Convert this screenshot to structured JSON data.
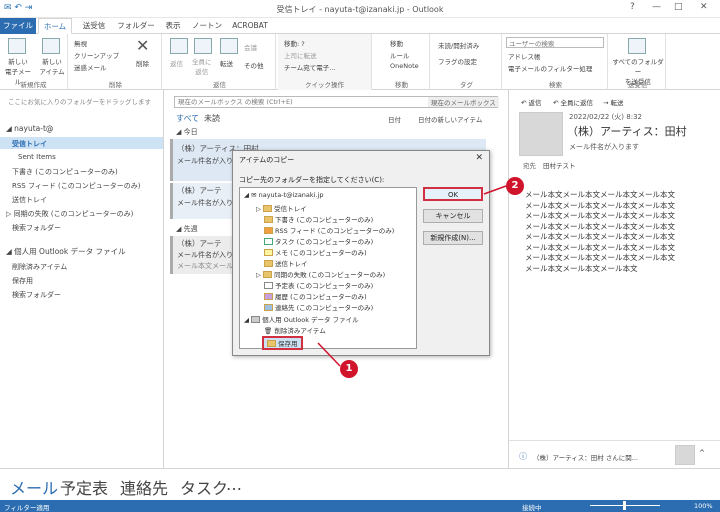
{
  "window": {
    "title": "受信トレイ - nayuta-t@izanaki.jp - Outlook",
    "controls": [
      "?",
      "—",
      "□",
      "✕"
    ]
  },
  "tabs": [
    "ファイル",
    "ホーム",
    "送受信",
    "フォルダー",
    "表示",
    "ノートン",
    "ACROBAT"
  ],
  "ribbon": {
    "new": {
      "new_mail": "新しい\n電子メール",
      "new_items": "新しい\nアイテム",
      "label": "新規作成"
    },
    "delete": {
      "ignore": "無視",
      "cleanup": "クリーンアップ",
      "junk": "迷惑メール",
      "delete": "削除",
      "label": "削除"
    },
    "respond": {
      "reply": "返信",
      "reply_all": "全員に\n返信",
      "forward": "転送",
      "meeting": "会議",
      "more": "その他",
      "label": "返信"
    },
    "quicksteps": {
      "move": "移動: ?",
      "to_boss": "上司に転送",
      "team": "チーム宛て電子...",
      "label": "クイック操作"
    },
    "move": {
      "move": "移動",
      "rules": "ルール",
      "onenote": "OneNote",
      "label": "移動"
    },
    "tags": {
      "unread": "未読/開封済み",
      "flag": "フラグの設定",
      "label": "タグ"
    },
    "find": {
      "search_people": "ユーザーの検索",
      "address_book": "アドレス帳",
      "filter": "電子メールのフィルター処理",
      "label": "検索"
    },
    "sendrecv": {
      "all": "すべてのフォルダー\nを送受信",
      "label": "送受信"
    }
  },
  "favorites_hint": "ここにお気に入りのフォルダーをドラッグします",
  "account": "nayuta-t@",
  "folders": [
    "受信トレイ",
    "Sent Items",
    "下書き (このコンピューターのみ)",
    "RSS フィード (このコンピューターのみ)",
    "送信トレイ",
    "同期の失敗 (このコンピューターのみ)",
    "検索フォルダー"
  ],
  "personal": {
    "header": "個人用 Outlook データ ファイル",
    "items": [
      "削除済みアイテム",
      "保存用",
      "検索フォルダー"
    ]
  },
  "mail": {
    "search_placeholder": "現在のメールボックス の検索 (Ctrl+E)",
    "scope": "現在のメールボックス",
    "filter_all": "すべて",
    "filter_unread": "未読",
    "sort_date": "日付",
    "sort_order": "日付の新しいアイテム",
    "group_today": "今日",
    "group_lastweek": "先週",
    "items": [
      {
        "sender": "（株）アーティス：田村",
        "subject": "メール件名が入り"
      },
      {
        "sender": "（株）アーテ",
        "subject": "メール件名が入り"
      },
      {
        "sender": "（株）アーテ",
        "subject": "メール件名が入り",
        "preview": "メール本文メール"
      }
    ]
  },
  "reading": {
    "reply": "返信",
    "reply_all": "全員に返信",
    "forward": "転送",
    "date": "2022/02/22 (火) 8:32",
    "sender": "（株）アーティス：田村",
    "subject": "メール件名が入ります",
    "to_label": "宛先",
    "to": "田村テスト",
    "body": [
      "メール本文メール本文メール本文メール本文",
      "メール本文メール本文メール本文メール本文",
      "メール本文メール本文メール本文メール本文",
      "メール本文メール本文メール本文メール本文",
      "メール本文メール本文メール本文メール本文",
      "メール本文メール本文メール本文メール本文",
      "メール本文メール本文メール本文メール本文",
      "メール本文メール本文メール本文"
    ],
    "people_bar": "（株）アーティス：田村 さんに関..."
  },
  "nav": [
    "メール",
    "予定表",
    "連絡先",
    "タスク",
    "…"
  ],
  "status": {
    "left": "フィルター適用",
    "connection": "接続中",
    "zoom": "100%"
  },
  "dialog": {
    "title": "アイテムのコピー",
    "prompt": "コピー先のフォルダーを指定してください(C):",
    "ok": "OK",
    "cancel": "キャンセル",
    "new": "新規作成(N)...",
    "tree": [
      {
        "label": "nayuta-t@izanaki.jp",
        "level": 0
      },
      {
        "label": "受信トレイ",
        "level": 1
      },
      {
        "label": "下書き (このコンピューターのみ)",
        "level": 1
      },
      {
        "label": "RSS フィード (このコンピューターのみ)",
        "level": 1
      },
      {
        "label": "タスク (このコンピューターのみ)",
        "level": 1
      },
      {
        "label": "メモ (このコンピューターのみ)",
        "level": 1
      },
      {
        "label": "送信トレイ",
        "level": 1
      },
      {
        "label": "同期の失敗 (このコンピューターのみ)",
        "level": 1
      },
      {
        "label": "予定表 (このコンピューターのみ)",
        "level": 1
      },
      {
        "label": "履歴 (このコンピューターのみ)",
        "level": 1
      },
      {
        "label": "連絡先 (このコンピューターのみ)",
        "level": 1
      },
      {
        "label": "個人用 Outlook データ ファイル",
        "level": 0
      },
      {
        "label": "削除済みアイテム",
        "level": 1
      },
      {
        "label": "保存用",
        "level": 1
      }
    ]
  },
  "callouts": [
    "1",
    "2"
  ],
  "colors": {
    "accent": "#2b6db0",
    "callout": "#d0142c",
    "highlight": "#d03040"
  }
}
